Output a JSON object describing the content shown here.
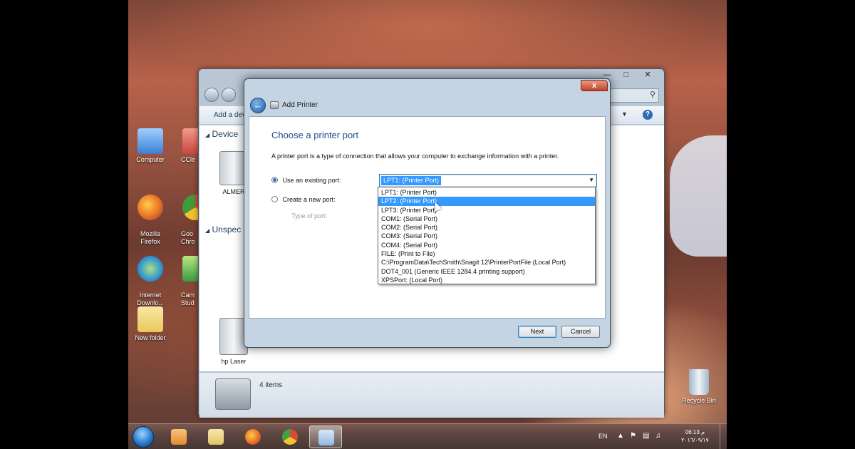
{
  "desktop": {
    "icons": [
      {
        "label": "Computer",
        "icon": "computer-icon",
        "color": "#3b7fd4"
      },
      {
        "label": "CCle",
        "icon": "ccleaner-icon",
        "color": "#c9463c"
      },
      {
        "label": "Mozilla\nFirefox",
        "icon": "firefox-icon",
        "color": "#e66a1f"
      },
      {
        "label": "Goo\nChro",
        "icon": "chrome-icon",
        "color": "#3f9c3a"
      },
      {
        "label": "Internet\nDownlo...",
        "icon": "internet-download-manager-icon",
        "color": "#2a8fd1"
      },
      {
        "label": "Cam\nStud",
        "icon": "camtasia-icon",
        "color": "#3a9a3f"
      },
      {
        "label": "New folder",
        "icon": "folder-icon",
        "color": "#e9c95b"
      },
      {
        "label": "Recycle Bin",
        "icon": "recycle-bin-icon",
        "color": "#c3d6e6"
      }
    ]
  },
  "bg_window": {
    "toolbar_label": "Add a dev",
    "sections": [
      "Device",
      "Unspec"
    ],
    "devices": [
      {
        "label": "ALMER",
        "icon": "printer-warning-icon"
      },
      {
        "label": "hp Laser",
        "icon": "printer-icon"
      }
    ],
    "status_items": "4 items",
    "search_icon": "search-icon",
    "help_icon": "help-icon",
    "help_label": "?"
  },
  "dialog": {
    "window_title": "Add Printer",
    "heading": "Choose a printer port",
    "description": "A printer port is a type of connection that allows your computer to exchange information with a printer.",
    "use_existing_label": "Use an existing port:",
    "create_new_label": "Create a new port:",
    "type_of_port_placeholder": "Type of port:",
    "selected_port": "LPT1: (Printer Port)",
    "port_options": [
      "LPT1: (Printer Port)",
      "LPT2: (Printer Port)",
      "LPT3: (Printer Port)",
      "COM1: (Serial Port)",
      "COM2: (Serial Port)",
      "COM3: (Serial Port)",
      "COM4: (Serial Port)",
      "FILE: (Print to File)",
      "C:\\ProgramData\\TechSmith\\Snagit 12\\PrinterPortFile (Local Port)",
      "DOT4_001 (Generic IEEE 1284.4 printing support)",
      "XPSPort: (Local Port)"
    ],
    "highlighted_port_index": 1,
    "next_label": "Next",
    "cancel_label": "Cancel",
    "close_label": "x"
  },
  "taskbar": {
    "apps": [
      {
        "icon": "windows-media-player-icon",
        "color": "#e58a2c"
      },
      {
        "icon": "file-explorer-icon",
        "color": "#e2c466"
      },
      {
        "icon": "firefox-icon",
        "color": "#e66a1f"
      },
      {
        "icon": "chrome-icon",
        "color": "#3fa343"
      },
      {
        "icon": "devices-and-printers-icon",
        "color": "#8fb9e3"
      }
    ],
    "language": "EN",
    "time": "06:13 م",
    "date": "٢٠١٦/٠٩/١٧"
  }
}
